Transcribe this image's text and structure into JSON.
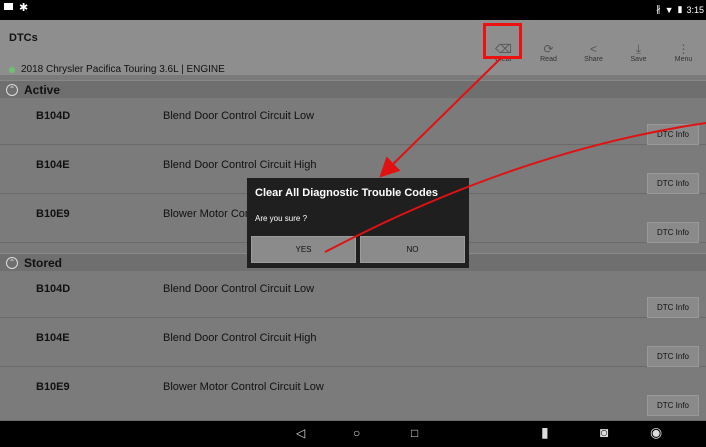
{
  "status": {
    "time": "3:15"
  },
  "header": {
    "title": "DTCs",
    "vehicle": "2018 Chrysler Pacifica Touring 3.6L | ENGINE"
  },
  "toolbar": [
    {
      "label": "Clear",
      "icon": "eraser-icon"
    },
    {
      "label": "Read",
      "icon": "refresh-icon"
    },
    {
      "label": "Share",
      "icon": "share-icon"
    },
    {
      "label": "Save",
      "icon": "download-icon"
    },
    {
      "label": "Menu",
      "icon": "menu-dots-icon"
    }
  ],
  "sections": [
    {
      "label": "Active"
    },
    {
      "label": "Stored"
    }
  ],
  "active_rows": [
    {
      "code": "B104D",
      "desc": "Blend Door Control Circuit Low",
      "btn": "DTC Info"
    },
    {
      "code": "B104E",
      "desc": "Blend Door Control Circuit High",
      "btn": "DTC Info"
    },
    {
      "code": "B10E9",
      "desc": "Blower Motor Control Circuit Low",
      "btn": "DTC Info"
    }
  ],
  "stored_rows": [
    {
      "code": "B104D",
      "desc": "Blend Door Control Circuit Low",
      "btn": "DTC Info"
    },
    {
      "code": "B104E",
      "desc": "Blend Door Control Circuit High",
      "btn": "DTC Info"
    },
    {
      "code": "B10E9",
      "desc": "Blower Motor Control Circuit Low",
      "btn": "DTC Info"
    }
  ],
  "dialog": {
    "title": "Clear All Diagnostic Trouble Codes",
    "message": "Are you sure ?",
    "yes": "YES",
    "no": "NO"
  },
  "annotation_color": "#e11111"
}
